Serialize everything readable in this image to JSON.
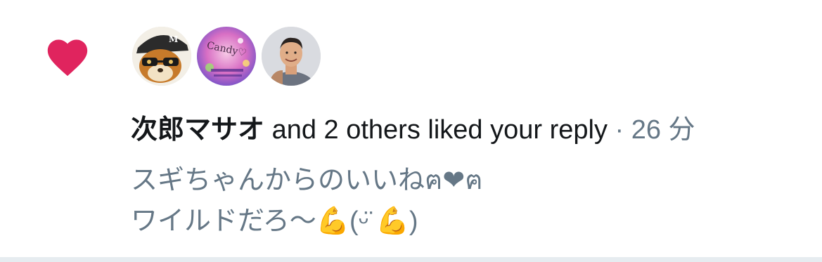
{
  "notification": {
    "actor": "次郎マサオ",
    "action": " and 2 others liked your reply",
    "separator": " · ",
    "time": "26 分",
    "reply_lines": [
      "スギちゃんからのいいねฅ❤ฅ",
      "ワイルドだろ〜💪(ᵕ̈ 💪)"
    ],
    "avatars": [
      {
        "name": "avatar-cat-cap",
        "caption": "M"
      },
      {
        "name": "avatar-candy",
        "caption": "Candy♡"
      },
      {
        "name": "avatar-man"
      }
    ]
  },
  "colors": {
    "heart": "#e0245e",
    "text_primary": "#14171a",
    "text_secondary": "#657786",
    "divider": "#e6ecf0"
  },
  "icons": {
    "like": "heart-icon"
  }
}
